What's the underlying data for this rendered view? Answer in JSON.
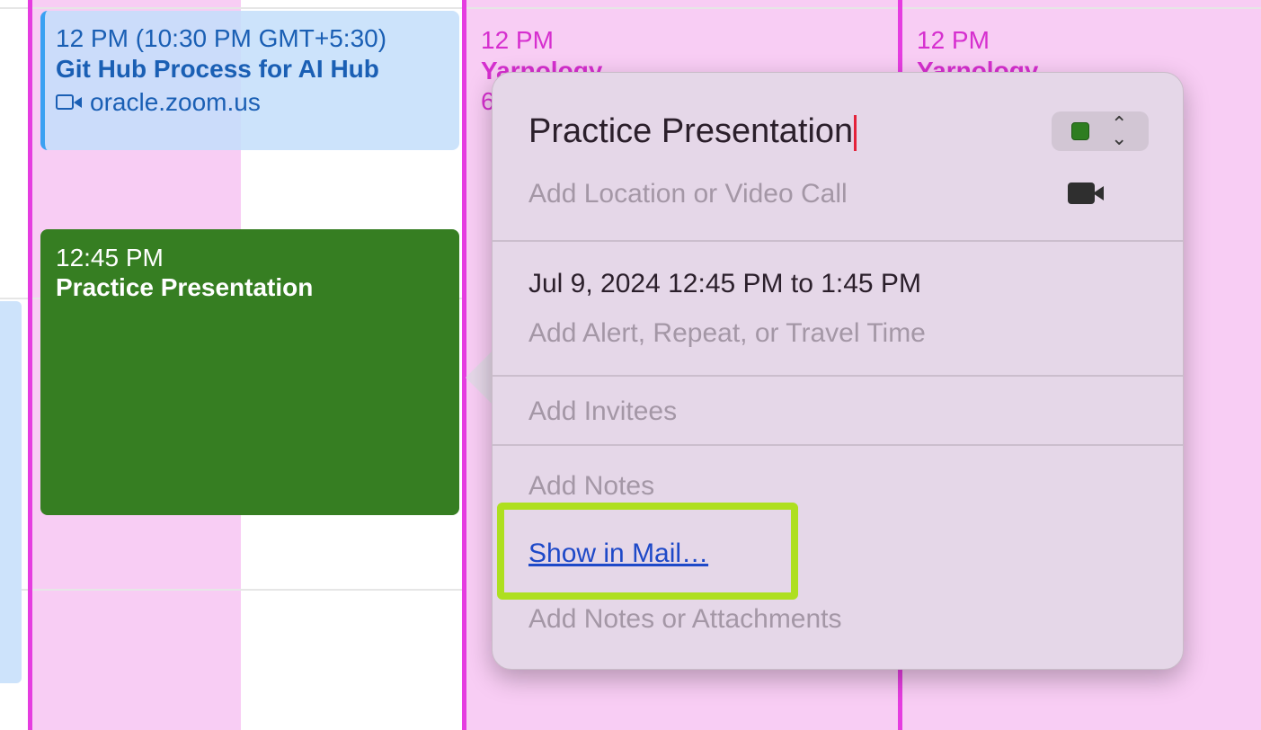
{
  "events": {
    "github": {
      "time": "12 PM (10:30 PM GMT+5:30)",
      "name": "Git Hub Process for AI Hub",
      "location": "oracle.zoom.us"
    },
    "yarnology_mid": {
      "time": "12 PM",
      "name": "Yarnology",
      "detail": "6"
    },
    "yarnology_right": {
      "time": "12 PM",
      "name": "Yarnology"
    },
    "practice": {
      "time": "12:45 PM",
      "name": "Practice Presentation"
    }
  },
  "popover": {
    "title": "Practice Presentation",
    "location_placeholder": "Add Location or Video Call",
    "date_range": "Jul 9, 2024  12:45 PM to 1:45 PM",
    "alert_placeholder": "Add Alert, Repeat, or Travel Time",
    "invitees_placeholder": "Add Invitees",
    "notes_placeholder": "Add Notes",
    "mail_link": "Show in Mail…",
    "attachments_placeholder": "Add Notes or Attachments",
    "calendar_color": "#2e7d20",
    "calendar_picker_icon": "chevron-up-down-icon",
    "video_icon": "video-camera-icon"
  },
  "colors": {
    "event_pink": "#f8cdf4",
    "event_pink_text": "#d62fcf",
    "event_blue": "#c3defa",
    "event_blue_text": "#1a5fb4",
    "event_green": "#367e22",
    "highlight": "#aedf1f"
  }
}
